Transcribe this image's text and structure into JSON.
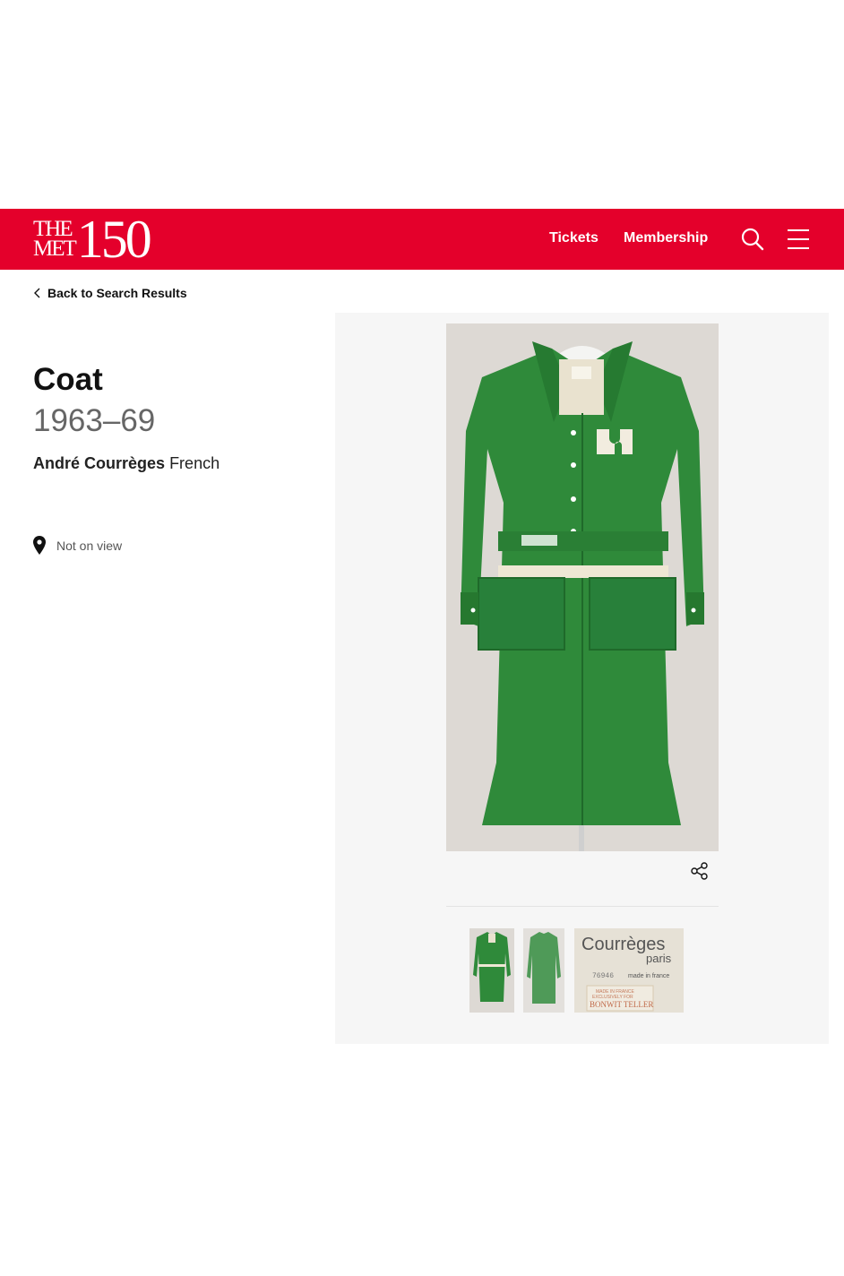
{
  "header": {
    "logo_top": "THE",
    "logo_bottom": "MET",
    "logo_number": "150",
    "nav": {
      "tickets": "Tickets",
      "membership": "Membership"
    },
    "icons": [
      "search-icon",
      "menu-icon"
    ],
    "background_color": "#e4002b"
  },
  "back_link": "Back to Search Results",
  "object": {
    "title": "Coat",
    "date": "1963–69",
    "artist_name": "André Courrèges",
    "artist_nationality": "French",
    "location": "Not on view"
  },
  "label_image": {
    "brand": "Courrèges",
    "city": "paris",
    "number": "76946",
    "made_in": "made in france",
    "made_in_caps": "MADE IN FRANCE",
    "exclusive": "EXCLUSIVELY FOR",
    "store": "BONWIT TELLER"
  },
  "colors": {
    "accent": "#e4002b",
    "coat": "#2f8a3a",
    "panel": "#f6f6f6"
  }
}
